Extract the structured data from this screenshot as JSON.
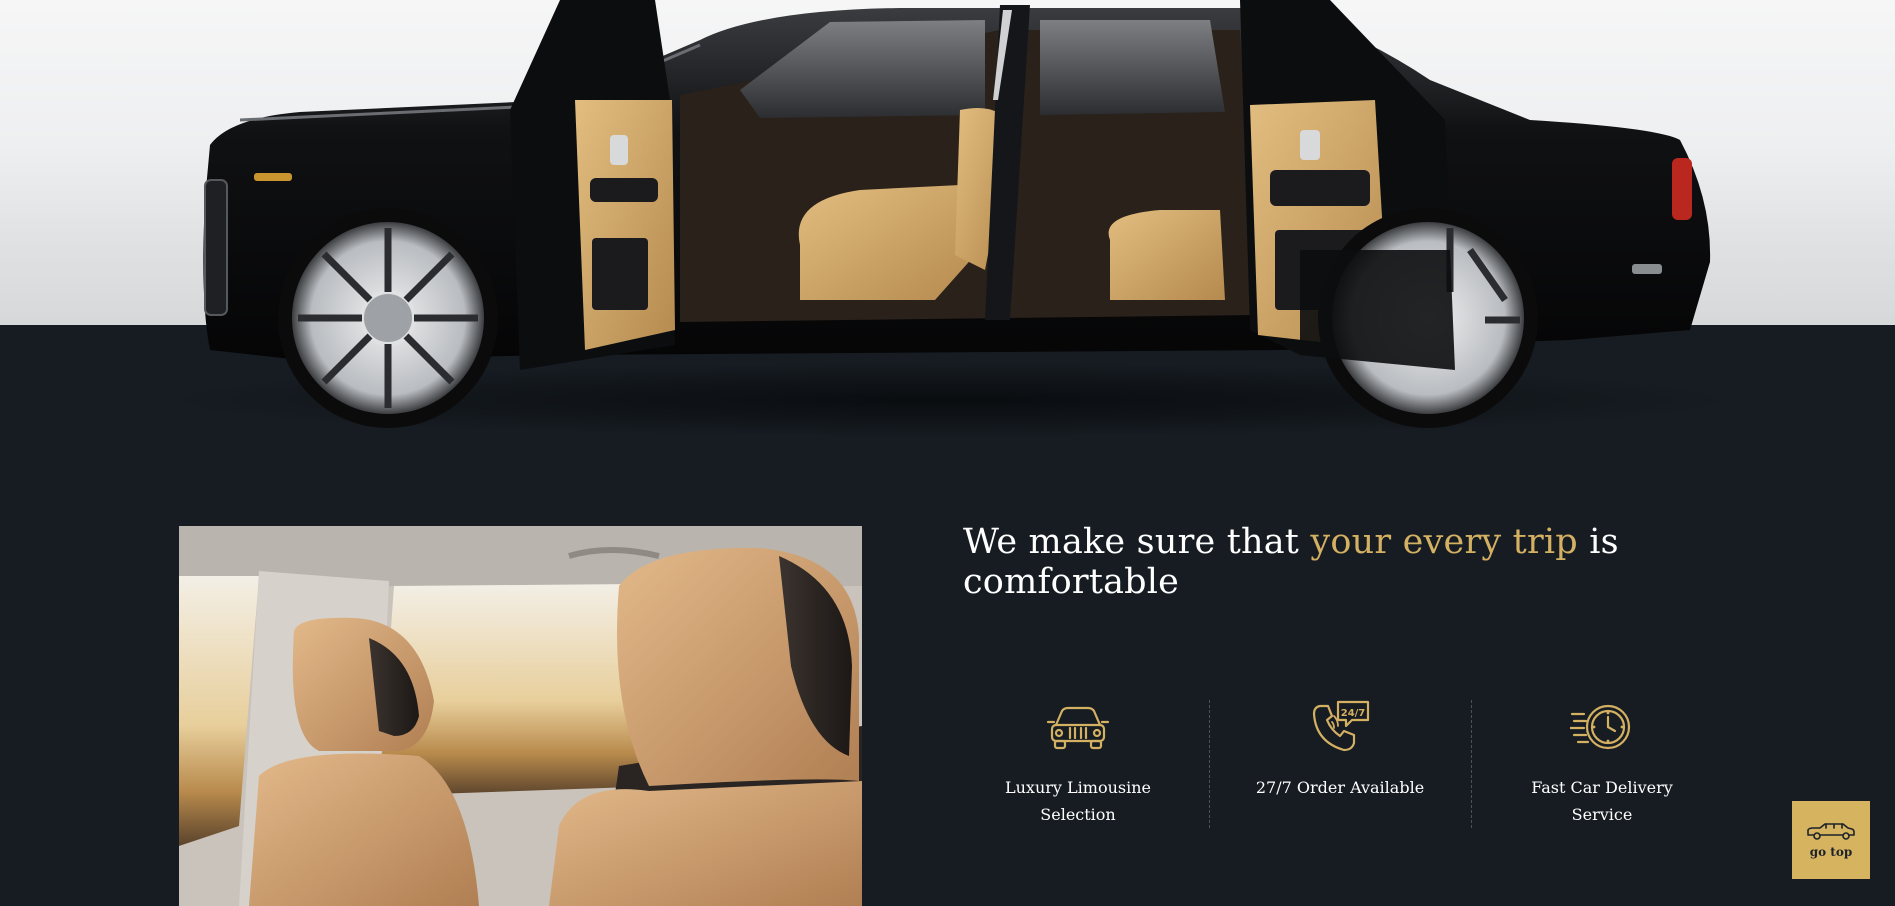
{
  "hero": {
    "image": "luxury-black-sedan-open-doors"
  },
  "feature_section": {
    "image": "tan-leather-car-seats",
    "headline": {
      "before": "We make sure that ",
      "accent": "your every trip",
      "after": " is comfortable"
    },
    "features": [
      {
        "icon": "limousine-icon",
        "label": "Luxury Limousine Selection"
      },
      {
        "icon": "phone-24-7-icon",
        "label": "27/7 Order Available"
      },
      {
        "icon": "fast-clock-icon",
        "label": "Fast Car Delivery Service"
      }
    ]
  },
  "go_top": {
    "label": "go top",
    "icon": "limousine-icon"
  },
  "colors": {
    "background": "#161c22",
    "accent": "#d3b062",
    "button": "#d6b35f"
  }
}
